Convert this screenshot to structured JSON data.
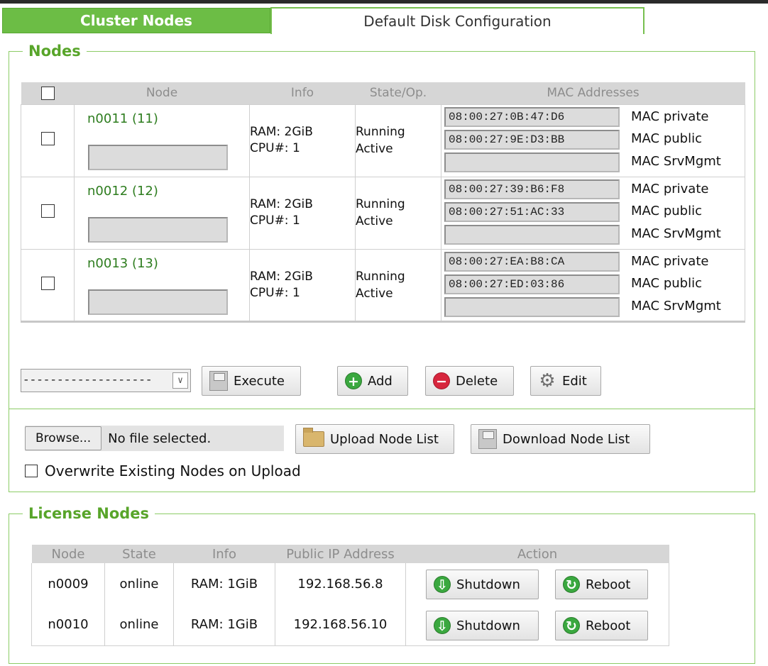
{
  "tabs": [
    {
      "label": "Cluster Nodes",
      "active": true
    },
    {
      "label": "Default Disk Configuration",
      "active": false
    }
  ],
  "nodes_section": {
    "title": "Nodes",
    "columns": [
      "Node",
      "Info",
      "State/Op.",
      "MAC Addresses"
    ],
    "rows": [
      {
        "name": "n0011 (11)",
        "ram": "RAM: 2GiB",
        "cpu": "CPU#: 1",
        "state": "Running",
        "op": "Active",
        "macs": [
          "08:00:27:0B:47:D6",
          "08:00:27:9E:D3:BB",
          ""
        ]
      },
      {
        "name": "n0012 (12)",
        "ram": "RAM: 2GiB",
        "cpu": "CPU#: 1",
        "state": "Running",
        "op": "Active",
        "macs": [
          "08:00:27:39:B6:F8",
          "08:00:27:51:AC:33",
          ""
        ]
      },
      {
        "name": "n0013 (13)",
        "ram": "RAM: 2GiB",
        "cpu": "CPU#: 1",
        "state": "Running",
        "op": "Active",
        "macs": [
          "08:00:27:EA:B8:CA",
          "08:00:27:ED:03:86",
          ""
        ]
      }
    ],
    "mac_labels": [
      "MAC private",
      "MAC public",
      "MAC SrvMgmt"
    ],
    "action_select": "-------------------",
    "buttons": {
      "execute": "Execute",
      "add": "Add",
      "delete": "Delete",
      "edit": "Edit"
    }
  },
  "upload": {
    "browse_label": "Browse...",
    "file_text": "No file selected.",
    "upload_label": "Upload Node List",
    "download_label": "Download Node List",
    "overwrite_label": "Overwrite Existing Nodes on Upload"
  },
  "license_section": {
    "title": "License Nodes",
    "columns": [
      "Node",
      "State",
      "Info",
      "Public IP Address",
      "Action"
    ],
    "rows": [
      {
        "node": "n0009",
        "state": "online",
        "info": "RAM: 1GiB",
        "ip": "192.168.56.8"
      },
      {
        "node": "n0010",
        "state": "online",
        "info": "RAM: 1GiB",
        "ip": "192.168.56.10"
      }
    ],
    "shutdown_label": "Shutdown",
    "reboot_label": "Reboot"
  },
  "icons": {
    "execute": "disk-icon",
    "add": "plus-circle-icon",
    "delete": "minus-circle-icon",
    "edit": "gear-icon",
    "upload": "folder-icon",
    "download": "disk-icon",
    "shutdown": "power-icon",
    "reboot": "reload-icon"
  },
  "colors": {
    "accent": "#6cbd45",
    "section_title": "#58a52a",
    "node_link": "#2e7d1f",
    "header_bg": "#d6d6d6"
  }
}
